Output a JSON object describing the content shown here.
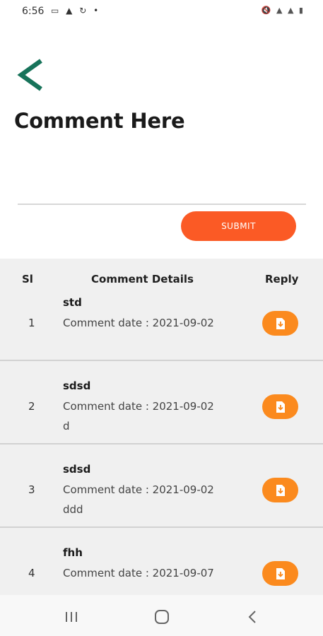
{
  "status_bar": {
    "time": "6:56",
    "left_icons": "▭ ▲ ↻ •",
    "right_icons": "🔇 ▲ ▲ ▮"
  },
  "page": {
    "title": "Comment Here",
    "comment_input_placeholder": "",
    "submit_label": "SUBMIT"
  },
  "table": {
    "headers": {
      "sl": "Sl",
      "details": "Comment Details",
      "reply": "Reply"
    },
    "rows": [
      {
        "sl": "1",
        "name": "std",
        "date": "Comment date : 2021-09-02",
        "text": ""
      },
      {
        "sl": "2",
        "name": "sdsd",
        "date": "Comment date : 2021-09-02",
        "text": "d"
      },
      {
        "sl": "3",
        "name": "sdsd",
        "date": "Comment date : 2021-09-02",
        "text": "ddd"
      },
      {
        "sl": "4",
        "name": "fhh",
        "date": "Comment date : 2021-09-07",
        "text": ""
      }
    ]
  },
  "colors": {
    "accent_green": "#17735a",
    "submit_orange": "#fb5a25",
    "reply_orange": "#fb8a1e"
  },
  "icons": {
    "back": "chevron-left-icon",
    "reply": "download-file-icon",
    "nav_recents": "recents-icon",
    "nav_home": "home-icon",
    "nav_back": "back-icon"
  }
}
